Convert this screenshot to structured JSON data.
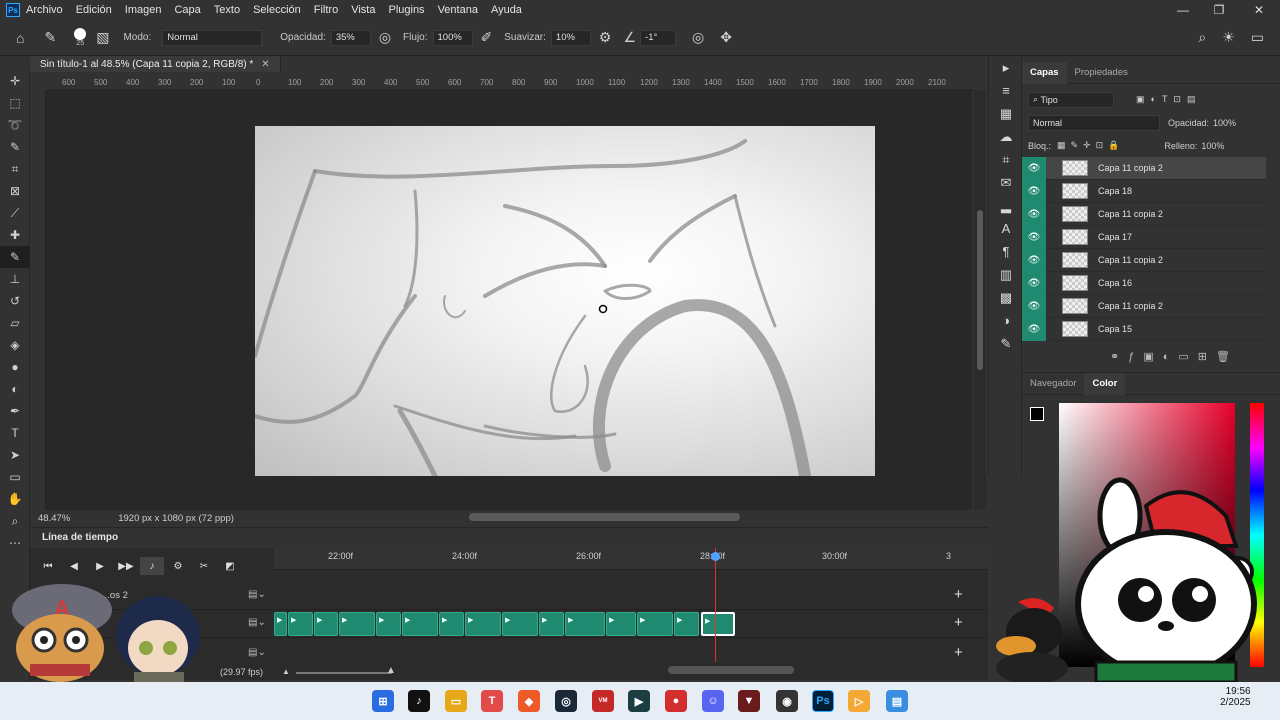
{
  "menu": {
    "logo": "Ps",
    "items": [
      "Archivo",
      "Edición",
      "Imagen",
      "Capa",
      "Texto",
      "Selección",
      "Filtro",
      "Vista",
      "Plugins",
      "Ventana",
      "Ayuda"
    ]
  },
  "options": {
    "brush_size": "25",
    "mode_label": "Modo:",
    "mode_value": "Normal",
    "opacity_label": "Opacidad:",
    "opacity_value": "35%",
    "flow_label": "Flujo:",
    "flow_value": "100%",
    "smooth_label": "Suavizar:",
    "smooth_value": "10%",
    "angle_value": "-1°"
  },
  "document": {
    "tab_title": "Sin título-1 al 48.5% (Capa 11 copia 2, RGB/8) *",
    "zoom": "48.47%",
    "info": "1920 px x 1080 px (72 ppp)"
  },
  "ruler_labels": [
    "600",
    "500",
    "400",
    "300",
    "200",
    "100",
    "0",
    "100",
    "200",
    "300",
    "400",
    "500",
    "600",
    "700",
    "800",
    "900",
    "1000",
    "1100",
    "1200",
    "1300",
    "1400",
    "1500",
    "1600",
    "1700",
    "1800",
    "1900",
    "2000",
    "2100"
  ],
  "timeline": {
    "title": "Línea de tiempo",
    "markers": [
      "22:00f",
      "24:00f",
      "26:00f",
      "28:00f",
      "30:00f",
      "3"
    ],
    "track_name": "...os 2",
    "fps": "(29.97 fps)"
  },
  "layers_panel": {
    "tabs": [
      "Capas",
      "Propiedades"
    ],
    "filter": "Tipo",
    "blend_mode": "Normal",
    "opacity_label": "Opacidad:",
    "opacity_value": "100%",
    "lock_label": "Bloq.:",
    "fill_label": "Relleno:",
    "fill_value": "100%",
    "layers": [
      {
        "name": "Capa 11 copia 2",
        "selected": true
      },
      {
        "name": "Capa 18",
        "selected": false
      },
      {
        "name": "Capa 11 copia 2",
        "selected": false
      },
      {
        "name": "Capa 17",
        "selected": false
      },
      {
        "name": "Capa 11 copia 2",
        "selected": false
      },
      {
        "name": "Capa 16",
        "selected": false
      },
      {
        "name": "Capa 11 copia 2",
        "selected": false
      },
      {
        "name": "Capa 15",
        "selected": false
      }
    ]
  },
  "color_panel": {
    "tabs": [
      "Navegador",
      "Color"
    ]
  },
  "taskbar": {
    "time": "19:56",
    "date": "2/2025"
  }
}
